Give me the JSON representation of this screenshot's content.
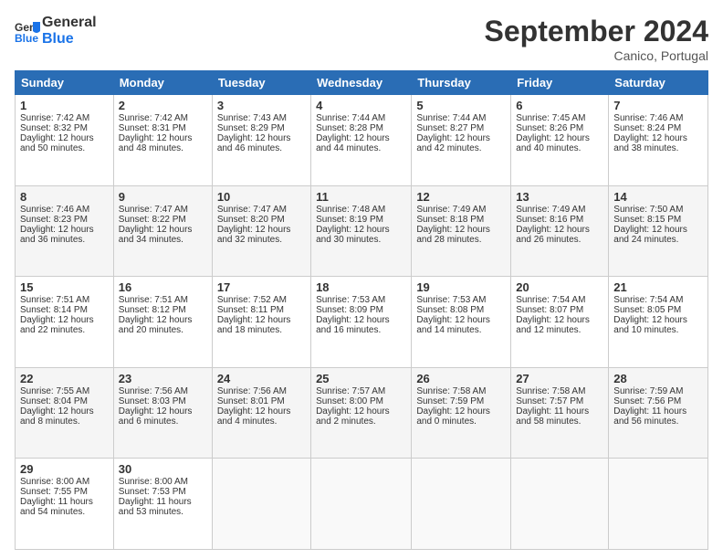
{
  "header": {
    "logo_line1": "General",
    "logo_line2": "Blue",
    "month_title": "September 2024",
    "subtitle": "Canico, Portugal"
  },
  "weekdays": [
    "Sunday",
    "Monday",
    "Tuesday",
    "Wednesday",
    "Thursday",
    "Friday",
    "Saturday"
  ],
  "weeks": [
    [
      {
        "day": "1",
        "sunrise": "7:42 AM",
        "sunset": "8:32 PM",
        "daylight": "12 hours and 50 minutes."
      },
      {
        "day": "2",
        "sunrise": "7:42 AM",
        "sunset": "8:31 PM",
        "daylight": "12 hours and 48 minutes."
      },
      {
        "day": "3",
        "sunrise": "7:43 AM",
        "sunset": "8:29 PM",
        "daylight": "12 hours and 46 minutes."
      },
      {
        "day": "4",
        "sunrise": "7:44 AM",
        "sunset": "8:28 PM",
        "daylight": "12 hours and 44 minutes."
      },
      {
        "day": "5",
        "sunrise": "7:44 AM",
        "sunset": "8:27 PM",
        "daylight": "12 hours and 42 minutes."
      },
      {
        "day": "6",
        "sunrise": "7:45 AM",
        "sunset": "8:26 PM",
        "daylight": "12 hours and 40 minutes."
      },
      {
        "day": "7",
        "sunrise": "7:46 AM",
        "sunset": "8:24 PM",
        "daylight": "12 hours and 38 minutes."
      }
    ],
    [
      {
        "day": "8",
        "sunrise": "7:46 AM",
        "sunset": "8:23 PM",
        "daylight": "12 hours and 36 minutes."
      },
      {
        "day": "9",
        "sunrise": "7:47 AM",
        "sunset": "8:22 PM",
        "daylight": "12 hours and 34 minutes."
      },
      {
        "day": "10",
        "sunrise": "7:47 AM",
        "sunset": "8:20 PM",
        "daylight": "12 hours and 32 minutes."
      },
      {
        "day": "11",
        "sunrise": "7:48 AM",
        "sunset": "8:19 PM",
        "daylight": "12 hours and 30 minutes."
      },
      {
        "day": "12",
        "sunrise": "7:49 AM",
        "sunset": "8:18 PM",
        "daylight": "12 hours and 28 minutes."
      },
      {
        "day": "13",
        "sunrise": "7:49 AM",
        "sunset": "8:16 PM",
        "daylight": "12 hours and 26 minutes."
      },
      {
        "day": "14",
        "sunrise": "7:50 AM",
        "sunset": "8:15 PM",
        "daylight": "12 hours and 24 minutes."
      }
    ],
    [
      {
        "day": "15",
        "sunrise": "7:51 AM",
        "sunset": "8:14 PM",
        "daylight": "12 hours and 22 minutes."
      },
      {
        "day": "16",
        "sunrise": "7:51 AM",
        "sunset": "8:12 PM",
        "daylight": "12 hours and 20 minutes."
      },
      {
        "day": "17",
        "sunrise": "7:52 AM",
        "sunset": "8:11 PM",
        "daylight": "12 hours and 18 minutes."
      },
      {
        "day": "18",
        "sunrise": "7:53 AM",
        "sunset": "8:09 PM",
        "daylight": "12 hours and 16 minutes."
      },
      {
        "day": "19",
        "sunrise": "7:53 AM",
        "sunset": "8:08 PM",
        "daylight": "12 hours and 14 minutes."
      },
      {
        "day": "20",
        "sunrise": "7:54 AM",
        "sunset": "8:07 PM",
        "daylight": "12 hours and 12 minutes."
      },
      {
        "day": "21",
        "sunrise": "7:54 AM",
        "sunset": "8:05 PM",
        "daylight": "12 hours and 10 minutes."
      }
    ],
    [
      {
        "day": "22",
        "sunrise": "7:55 AM",
        "sunset": "8:04 PM",
        "daylight": "12 hours and 8 minutes."
      },
      {
        "day": "23",
        "sunrise": "7:56 AM",
        "sunset": "8:03 PM",
        "daylight": "12 hours and 6 minutes."
      },
      {
        "day": "24",
        "sunrise": "7:56 AM",
        "sunset": "8:01 PM",
        "daylight": "12 hours and 4 minutes."
      },
      {
        "day": "25",
        "sunrise": "7:57 AM",
        "sunset": "8:00 PM",
        "daylight": "12 hours and 2 minutes."
      },
      {
        "day": "26",
        "sunrise": "7:58 AM",
        "sunset": "7:59 PM",
        "daylight": "12 hours and 0 minutes."
      },
      {
        "day": "27",
        "sunrise": "7:58 AM",
        "sunset": "7:57 PM",
        "daylight": "11 hours and 58 minutes."
      },
      {
        "day": "28",
        "sunrise": "7:59 AM",
        "sunset": "7:56 PM",
        "daylight": "11 hours and 56 minutes."
      }
    ],
    [
      {
        "day": "29",
        "sunrise": "8:00 AM",
        "sunset": "7:55 PM",
        "daylight": "11 hours and 54 minutes."
      },
      {
        "day": "30",
        "sunrise": "8:00 AM",
        "sunset": "7:53 PM",
        "daylight": "11 hours and 53 minutes."
      },
      null,
      null,
      null,
      null,
      null
    ]
  ]
}
